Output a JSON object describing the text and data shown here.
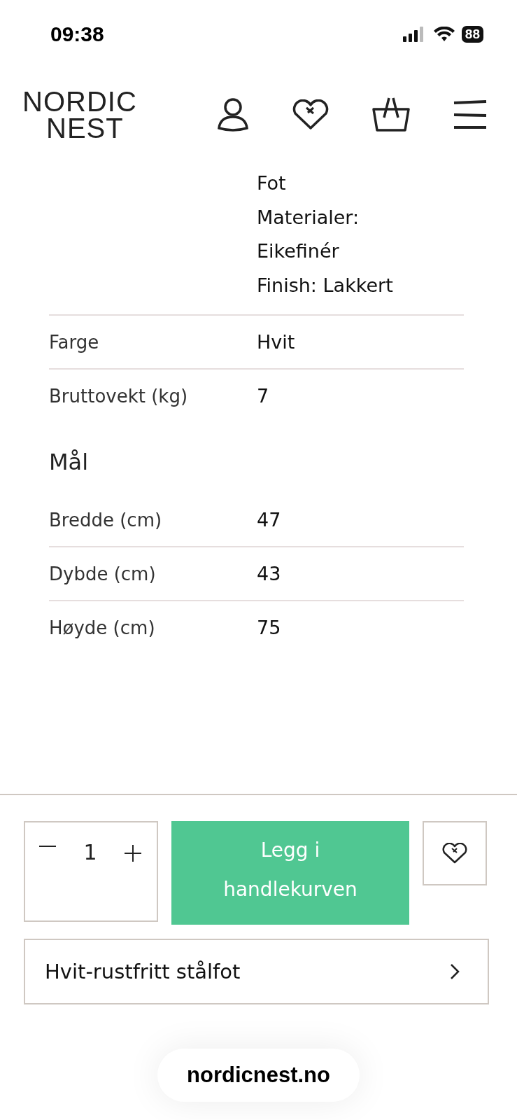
{
  "status_bar": {
    "time": "09:38",
    "battery": "88"
  },
  "header": {
    "logo": [
      "NORDIC",
      "NEST"
    ]
  },
  "specs_top": [
    {
      "value_lines": [
        "Fot",
        "Materialer:",
        "Eikefinér",
        "Finish: Lakkert"
      ]
    },
    {
      "label": "Farge",
      "value_lines": [
        "Hvit"
      ]
    },
    {
      "label": "Bruttovekt (kg)",
      "value_lines": [
        "7"
      ]
    }
  ],
  "section_title": "Mål",
  "specs_dimensions": [
    {
      "label": "Bredde (cm)",
      "value": "47"
    },
    {
      "label": "Dybde (cm)",
      "value": "43"
    },
    {
      "label": "Høyde (cm)",
      "value": "75"
    }
  ],
  "purchase": {
    "quantity": "1",
    "add_button": "Legg i handlekurven",
    "variant": "Hvit-rustfritt stålfot"
  },
  "address_bar": {
    "url": "nordicnest.no"
  }
}
